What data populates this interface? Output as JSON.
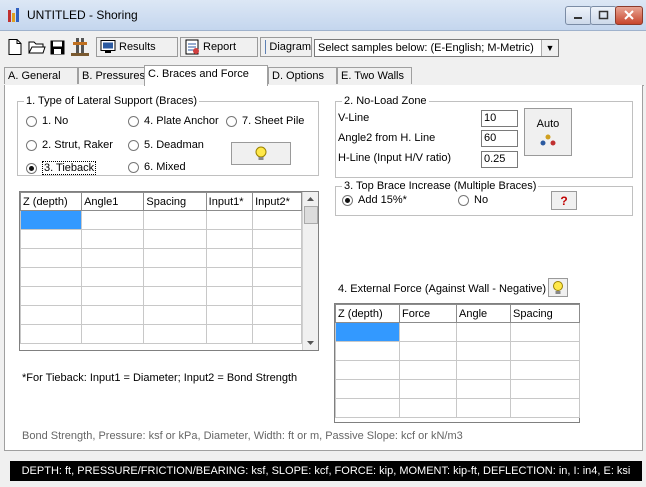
{
  "window": {
    "title": "UNTITLED - Shoring"
  },
  "toolbar": {
    "results_label": "Results",
    "report_label": "Report",
    "diagram_label": "Diagram",
    "samples_combo": "Select samples below:  (E-English; M-Metric)"
  },
  "tabs": [
    {
      "label": "A. General"
    },
    {
      "label": "B. Pressures"
    },
    {
      "label": "C. Braces and Force"
    },
    {
      "label": "D. Options"
    },
    {
      "label": "E. Two Walls"
    }
  ],
  "support": {
    "legend": "1. Type of Lateral Support (Braces)",
    "options": [
      {
        "label": "1. No",
        "checked": false
      },
      {
        "label": "2. Strut, Raker",
        "checked": false
      },
      {
        "label": "3. Tieback",
        "checked": true
      },
      {
        "label": "4. Plate Anchor",
        "checked": false
      },
      {
        "label": "5. Deadman",
        "checked": false
      },
      {
        "label": "6. Mixed",
        "checked": false
      },
      {
        "label": "7. Sheet Pile",
        "checked": false
      }
    ]
  },
  "braces_table": {
    "columns": [
      "Z (depth)",
      "Angle1",
      "Spacing",
      "Input1*",
      "Input2*"
    ]
  },
  "tieback_note": "*For Tieback:  Input1 = Diameter;  Input2 = Bond Strength",
  "no_load": {
    "legend": "2. No-Load Zone",
    "vline_label": "V-Line",
    "vline_value": "10",
    "angle2_label": "Angle2 from H. Line",
    "angle2_value": "60",
    "hline_label": "H-Line (Input H/V ratio)",
    "hline_value": "0.25",
    "auto_label": "Auto"
  },
  "top_brace": {
    "legend": "3. Top Brace Increase (Multiple Braces)",
    "add_label": "Add 15%*",
    "add_checked": true,
    "no_label": "No",
    "no_checked": false,
    "help_label": "?"
  },
  "external_force": {
    "label": "4. External Force (Against Wall - Negative)",
    "columns": [
      "Z (depth)",
      "Force",
      "Angle",
      "Spacing"
    ]
  },
  "units_note": "Bond Strength, Pressure: ksf or kPa, Diameter, Width: ft or m, Passive Slope: kcf or  kN/m3",
  "status": "DEPTH: ft, PRESSURE/FRICTION/BEARING: ksf, SLOPE: kcf, FORCE: kip, MOMENT: kip-ft, DEFLECTION: in, I: in4, E: ksi"
}
